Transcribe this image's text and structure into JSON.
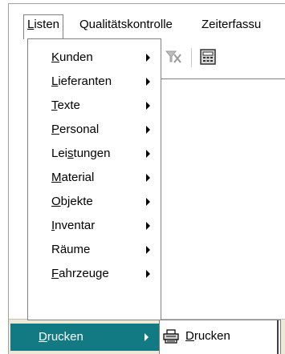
{
  "menubar": {
    "items": [
      {
        "label_u": "L",
        "label_rest": "isten"
      },
      {
        "label": "Qualitätskontrolle"
      },
      {
        "label": "Zeiterfassu"
      }
    ]
  },
  "menu": {
    "items": [
      {
        "pre": "",
        "u": "K",
        "post": "unden"
      },
      {
        "pre": "",
        "u": "L",
        "post": "ieferanten"
      },
      {
        "pre": "",
        "u": "T",
        "post": "exte"
      },
      {
        "pre": "",
        "u": "P",
        "post": "ersonal"
      },
      {
        "pre": "Lei",
        "u": "s",
        "post": "tungen"
      },
      {
        "pre": "",
        "u": "M",
        "post": "aterial"
      },
      {
        "pre": "",
        "u": "O",
        "post": "bjekte"
      },
      {
        "pre": "",
        "u": "I",
        "post": "nventar"
      },
      {
        "pre": "Räume",
        "u": "",
        "post": ""
      },
      {
        "pre": "",
        "u": "F",
        "post": "ahrzeuge"
      }
    ],
    "highlighted": {
      "pre": "",
      "u": "D",
      "post": "rucken"
    }
  },
  "submenu": {
    "item": {
      "pre": "",
      "u": "D",
      "post": "rucken"
    },
    "icon": "printer-icon"
  },
  "toolbar": {
    "icons": [
      "filter-off-icon",
      "calculator-icon"
    ]
  },
  "colors": {
    "highlight": "#127a82"
  }
}
